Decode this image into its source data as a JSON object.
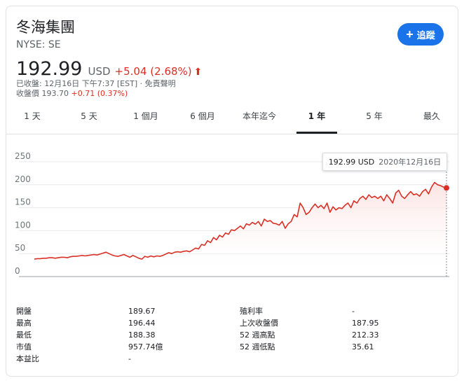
{
  "header": {
    "company": "冬海集團",
    "ticker": "NYSE: SE",
    "follow_label": "追蹤"
  },
  "quote": {
    "price": "192.99",
    "currency": "USD",
    "change": "+5.04 (2.68%)",
    "closed_line": "已收盤: 12月16日 下午7:37 [EST] · 免責聲明",
    "after_label": "收盤價",
    "after_price": "193.70",
    "after_change": "+0.71 (0.37%)"
  },
  "tabs": [
    {
      "label": "1 天",
      "active": false
    },
    {
      "label": "5 天",
      "active": false
    },
    {
      "label": "1 個月",
      "active": false
    },
    {
      "label": "6 個月",
      "active": false
    },
    {
      "label": "本年迄今",
      "active": false
    },
    {
      "label": "1 年",
      "active": true
    },
    {
      "label": "5 年",
      "active": false
    },
    {
      "label": "最久",
      "active": false
    }
  ],
  "tooltip": {
    "value": "192.99 USD",
    "date": "2020年12月16日"
  },
  "stats": {
    "left": [
      {
        "label": "開盤",
        "value": "189.67"
      },
      {
        "label": "最高",
        "value": "196.44"
      },
      {
        "label": "最低",
        "value": "188.38"
      },
      {
        "label": "市值",
        "value": "957.74億"
      },
      {
        "label": "本益比",
        "value": "-"
      }
    ],
    "right": [
      {
        "label": "殖利率",
        "value": "-"
      },
      {
        "label": "上次收盤價",
        "value": "187.95"
      },
      {
        "label": "52 週高點",
        "value": "212.33"
      },
      {
        "label": "52 週低點",
        "value": "35.61"
      }
    ]
  },
  "colors": {
    "line": "#d93025",
    "fill_top": "#fbe3e1",
    "accent": "#1a73e8",
    "grid": "#e8eaed"
  },
  "chart_data": {
    "type": "area",
    "y_ticks": [
      "250",
      "200",
      "150",
      "100",
      "50",
      "0"
    ],
    "ylim": [
      0,
      250
    ],
    "grid": true,
    "series": [
      {
        "values": [
          38,
          39,
          39,
          40,
          40,
          41,
          41,
          40,
          41,
          42,
          42,
          41,
          43,
          44,
          44,
          45,
          46,
          45,
          46,
          47,
          48,
          47,
          49,
          51,
          53,
          50,
          47,
          45,
          44,
          46,
          48,
          45,
          42,
          46,
          43,
          40,
          38,
          44,
          42,
          45,
          43,
          45,
          44,
          46,
          49,
          52,
          50,
          53,
          54,
          53,
          55,
          56,
          54,
          58,
          62,
          60,
          70,
          68,
          78,
          74,
          85,
          80,
          90,
          86,
          95,
          92,
          102,
          100,
          105,
          110,
          104,
          115,
          112,
          118,
          114,
          120,
          110,
          125,
          120,
          122,
          116,
          115,
          112,
          120,
          105,
          115,
          120,
          135,
          130,
          160,
          150,
          135,
          140,
          150,
          158,
          150,
          155,
          148,
          160,
          140,
          152,
          145,
          150,
          148,
          155,
          160,
          150,
          165,
          160,
          170,
          175,
          168,
          178,
          172,
          175,
          170,
          175,
          165,
          178,
          170,
          160,
          182,
          188,
          175,
          170,
          178,
          185,
          178,
          180,
          175,
          185,
          190,
          180,
          195,
          205,
          200,
          198,
          195,
          192.99
        ]
      }
    ]
  }
}
